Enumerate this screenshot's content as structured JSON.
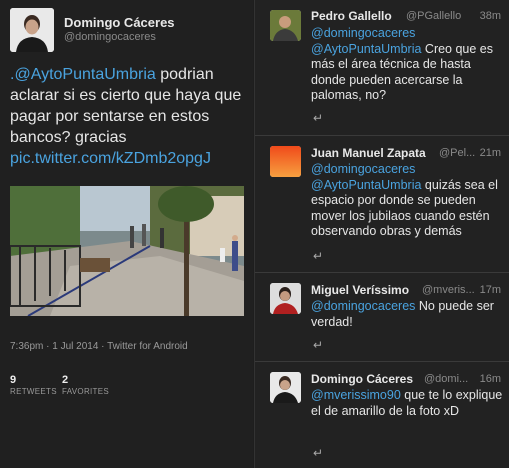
{
  "main_tweet": {
    "author_name": "Domingo Cáceres",
    "author_handle": "@domingocaceres",
    "text_mention": ".@AytoPuntaUmbria",
    "text_body": " podrian aclarar si es cierto que haya que pagar por sentarse en estos bancos? gracias",
    "text_link": "pic.twitter.com/kZDmb2opgJ",
    "timestamp": "7:36pm · 1 Jul 2014 · Twitter for Android",
    "retweets_count": "9",
    "retweets_label": "RETWEETS",
    "favorites_count": "2",
    "favorites_label": "FAVORITES"
  },
  "replies": [
    {
      "name": "Pedro Gallello",
      "handle": "@PGallello",
      "time": "38m",
      "mention1": "@domingocaceres",
      "mention2": "@AytoPuntaUmbria",
      "text": " Creo que es más el área técnica de hasta donde pueden acercarse la palomas, no?"
    },
    {
      "name": "Juan Manuel Zapata",
      "handle": "@Pel...",
      "time": "21m",
      "mention1": "@domingocaceres",
      "mention2": "@AytoPuntaUmbria",
      "text": " quizás sea el espacio por donde se pueden mover los jubilaos cuando estén observando obras y demás"
    },
    {
      "name": "Miguel Veríssimo",
      "handle": "@mveris...",
      "time": "17m",
      "mention1": "@domingocaceres",
      "mention2": "",
      "text": " No puede ser verdad!"
    },
    {
      "name": "Domingo Cáceres",
      "handle": "@domi...",
      "time": "16m",
      "mention1": "@mverissimo90",
      "mention2": "",
      "text": " que te lo explique el de amarillo de la foto xD"
    }
  ],
  "icons": {
    "reply": "reply-icon"
  },
  "colors": {
    "link": "#4aa3df",
    "background": "#202020"
  }
}
